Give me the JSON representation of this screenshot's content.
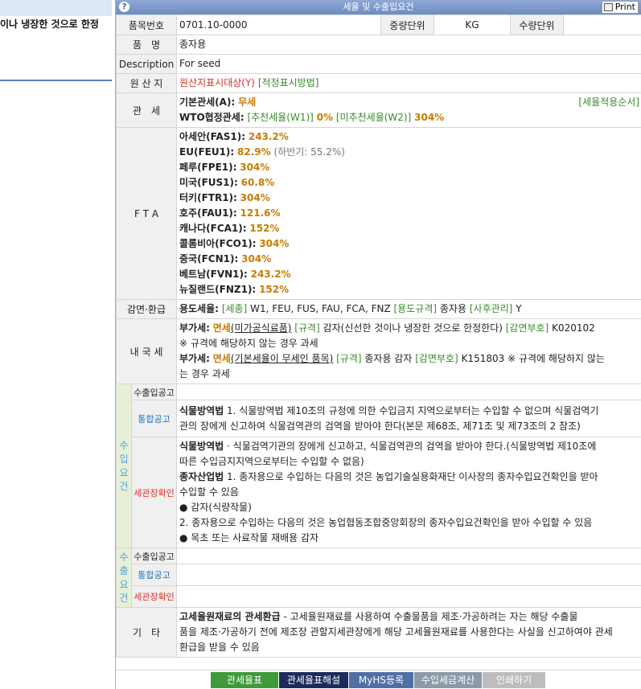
{
  "left_panel": {
    "text": "이나 냉장한 것으로 한정"
  },
  "window": {
    "title": "세율 및 수출입요건",
    "help_icon": "help-icon",
    "print_label": "Print"
  },
  "product": {
    "code_label": "품목번호",
    "code": "0701.10-0000",
    "weight_unit_label": "중량단위",
    "weight_unit": "KG",
    "qty_unit_label": "수량단위",
    "qty_unit": "",
    "name_label": "품　명",
    "name": "종자용",
    "desc_label": "Description",
    "desc": "For seed",
    "origin_label": "원 산 지",
    "origin_value": "원산지표시대상(Y)",
    "origin_link": "[적정표시방법]"
  },
  "tariff": {
    "label": "관　세",
    "basic_label": "기본관세(A):",
    "basic_value": "무세",
    "order_link": "[세율적용순서]",
    "wto_label": "WTO협정관세:",
    "wto_w1": "[추천세율(W1)]",
    "wto_w1_value": "0%",
    "wto_w2": "[미추천세율(W2)]",
    "wto_w2_value": "304%"
  },
  "fta": {
    "label": "F T A",
    "items": [
      {
        "name": "아세안(FAS1):",
        "value": "243.2%",
        "extra": ""
      },
      {
        "name": "EU(FEU1):",
        "value": "82.9%",
        "extra": "(하반기: 55.2%)"
      },
      {
        "name": "페루(FPE1):",
        "value": "304%",
        "extra": ""
      },
      {
        "name": "미국(FUS1):",
        "value": "60.8%",
        "extra": ""
      },
      {
        "name": "터키(FTR1):",
        "value": "304%",
        "extra": ""
      },
      {
        "name": "호주(FAU1):",
        "value": "121.6%",
        "extra": ""
      },
      {
        "name": "캐나다(FCA1):",
        "value": "152%",
        "extra": ""
      },
      {
        "name": "콜롬비아(FCO1):",
        "value": "304%",
        "extra": ""
      },
      {
        "name": "중국(FCN1):",
        "value": "304%",
        "extra": ""
      },
      {
        "name": "베트남(FVN1):",
        "value": "243.2%",
        "extra": ""
      },
      {
        "name": "뉴질랜드(FNZ1):",
        "value": "152%",
        "extra": ""
      }
    ]
  },
  "reduction": {
    "label": "감면·환급",
    "title": "용도세율:",
    "l1": "[세종]",
    "v1": "W1, FEU, FUS, FAU, FCA, FNZ",
    "l2": "[용도규격]",
    "v2": "종자용",
    "l3": "[사후관리]",
    "v3": "Y"
  },
  "domestic": {
    "label": "내 국 세",
    "vat1_label": "부가세:",
    "vat1_value": "면세",
    "vat1_link": "(미가공식료품)",
    "vat1_spec_label": "[규격]",
    "vat1_spec": "감자(신선한 것이나 냉장한 것으로 한정한다)",
    "vat1_code_label": "[감면부호]",
    "vat1_code": "K020102",
    "vat1_note": "※ 규격에 해당하지 않는 경우 과세",
    "vat2_label": "부가세:",
    "vat2_value": "면세",
    "vat2_link": "(기본세율이 무세인 품목)",
    "vat2_spec_label": "[규격]",
    "vat2_spec": "종자용 감자",
    "vat2_code_label": "[감면부호]",
    "vat2_code": "K151803",
    "vat2_note_a": "※ 규격에 해당하지 않는",
    "vat2_note_b": "는 경우 과세"
  },
  "import_req": {
    "side": [
      "수",
      "입",
      "요",
      "건"
    ],
    "notice_label": "수출입공고",
    "integrated_label": "통합공고",
    "integrated_title": "식물방역법",
    "integrated_text_a": "1. 식물방역법 제10조의 규정에 의한 수입금지 지역으로부터는 수입할 수 없으며 식물검역기",
    "integrated_text_b": "관의 장에게 신고하여 식물검역관의 검역을 받아야 한다(본문 제68조, 제71조 및 제73조의 2 참조)",
    "customs_label": "세관장확인",
    "c1_title": "식물방역법",
    "c1_text_a": "· 식물검역기관의 장에게 신고하고, 식물검역관의 검역을 받아야 한다.(식물방역법 제10조에",
    "c1_text_b": "따른 수입금지지역으로부터는 수입할 수 없음)",
    "c2_title": "종자산업법",
    "c2_text_a": "1. 종자용으로 수입하는 다음의 것은 농업기술실용화재단 이사장의 종자수입요건확인을 받아",
    "c2_text_b": "수입할 수 있음",
    "c2_b1": "● 감자(식량작물)",
    "c2_text_c": "2. 종자용으로 수입하는 다음의 것은 농업협동조합중앙회장의 종자수입요건확인을 받아 수입할 수 있음",
    "c2_b2": "● 목초 또는 사료작물 재배용 감자"
  },
  "export_req": {
    "side": [
      "수",
      "출",
      "요",
      "건"
    ],
    "notice_label": "수출입공고",
    "integrated_label": "통합공고",
    "customs_label": "세관장확인"
  },
  "etc": {
    "label": "기　타",
    "title": "고세율원재료의 관세환급",
    "text_a": " - 고세율원재료를 사용하여 수출물품을 제조·가공하려는 자는 해당 수출물",
    "text_b": "품을 제조·가공하기 전에 제조장 관할지세관장에게 해당 고세율원재료를 사용한다는 사실을 신고하여야 관세",
    "text_c": "환급을 받을 수 있음"
  },
  "buttons": [
    {
      "label": "관세율표",
      "color": "#3e9a3b"
    },
    {
      "label": "관세율표해설",
      "color": "#1c2a5c"
    },
    {
      "label": "MyHS등록",
      "color": "#4f6fa6"
    },
    {
      "label": "수입세금계산",
      "color": "#8c9aa8"
    },
    {
      "label": "인쇄하기",
      "color": "#bdbdbd"
    }
  ]
}
